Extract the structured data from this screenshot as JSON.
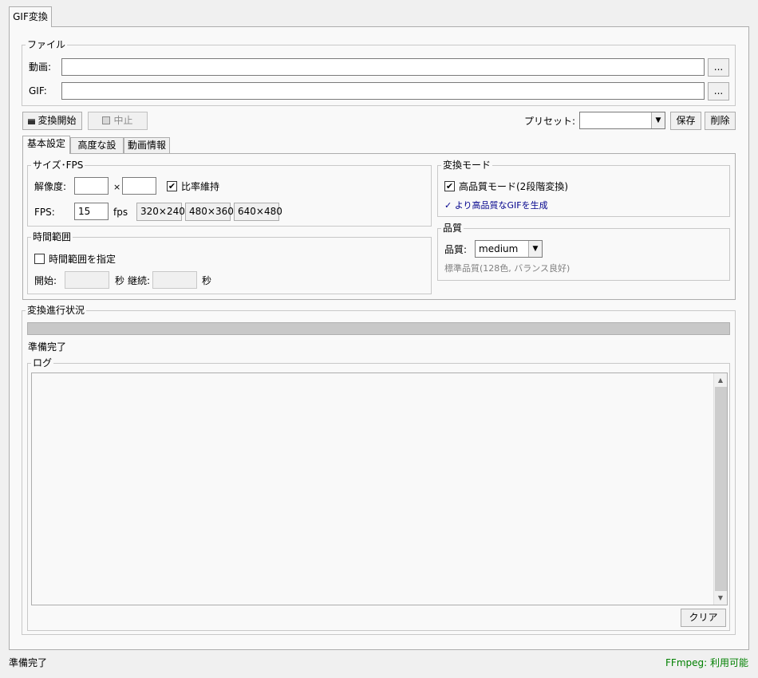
{
  "window": {
    "tab_label": "GIF変換"
  },
  "file_group": {
    "legend": "ファイル",
    "video_label": "動画:",
    "video_value": "",
    "gif_label": "GIF:",
    "gif_value": "",
    "browse_label": "..."
  },
  "toolbar": {
    "start_label": "変換開始",
    "stop_label": "中止",
    "preset_label": "プリセット:",
    "preset_value": "",
    "save_label": "保存",
    "delete_label": "削除"
  },
  "subtabs": [
    "基本設定",
    "高度な設定",
    "動画情報"
  ],
  "size_fps": {
    "legend": "サイズ･FPS",
    "resolution_label": "解像度:",
    "width_value": "",
    "height_value": "",
    "times_sign": "×",
    "keep_ratio_label": "比率維持",
    "keep_ratio_checked": true,
    "fps_label": "FPS:",
    "fps_value": "15",
    "fps_unit": "fps",
    "presets": [
      "320×240",
      "480×360",
      "640×480"
    ]
  },
  "time_range": {
    "legend": "時間範囲",
    "specify_label": "時間範囲を指定",
    "specify_checked": false,
    "start_label": "開始:",
    "start_value": "",
    "sec_label": "秒",
    "duration_label": "継続:",
    "duration_value": ""
  },
  "mode": {
    "legend": "変換モード",
    "hq_label": "高品質モード(2段階変換)",
    "hq_checked": true,
    "hint": "✓ より高品質なGIFを生成",
    "hint_color": "#00008b"
  },
  "quality": {
    "legend": "品質",
    "label": "品質:",
    "value": "medium",
    "description": "標準品質(128色, バランス良好)"
  },
  "progress": {
    "legend": "変換進行状況",
    "percent": 0,
    "status": "準備完了"
  },
  "log": {
    "legend": "ログ",
    "content": "",
    "clear_label": "クリア"
  },
  "statusbar": {
    "left": "準備完了",
    "right": "FFmpeg: 利用可能",
    "right_color": "#008000"
  }
}
